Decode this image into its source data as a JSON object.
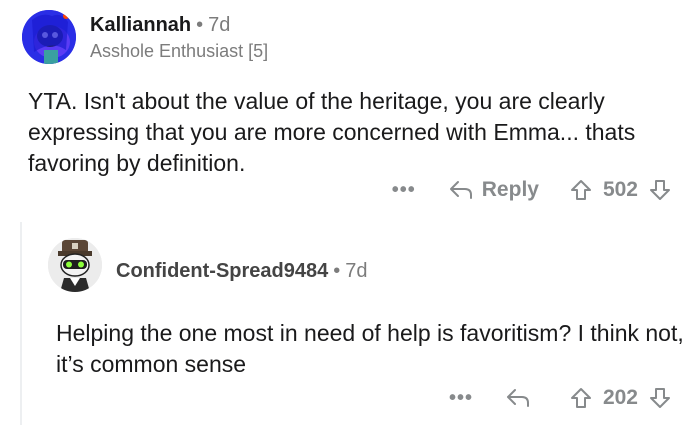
{
  "comments": [
    {
      "author": "Kalliannah",
      "separator": "•",
      "age": "7d",
      "flair": "Asshole Enthusiast [5]",
      "body": "YTA. Isn't about the value of the heritage, you are clearly expressing that you are more concerned with Emma... thats favoring by definition.",
      "more": "•••",
      "reply_label": "Reply",
      "score": "502"
    },
    {
      "author": "Confident-Spread9484",
      "separator": "•",
      "age": "7d",
      "body": "Helping the one most in need of help is favoritism? I think not, it’s common sense",
      "more": "•••",
      "score": "202"
    }
  ],
  "colors": {
    "text": "#1a1a1b",
    "meta": "#7c7c7c",
    "action": "#878a8c",
    "avatar1": "#3a3df0"
  },
  "icons": [
    "more-icon",
    "reply-arrow-icon",
    "upvote-icon",
    "downvote-icon"
  ]
}
